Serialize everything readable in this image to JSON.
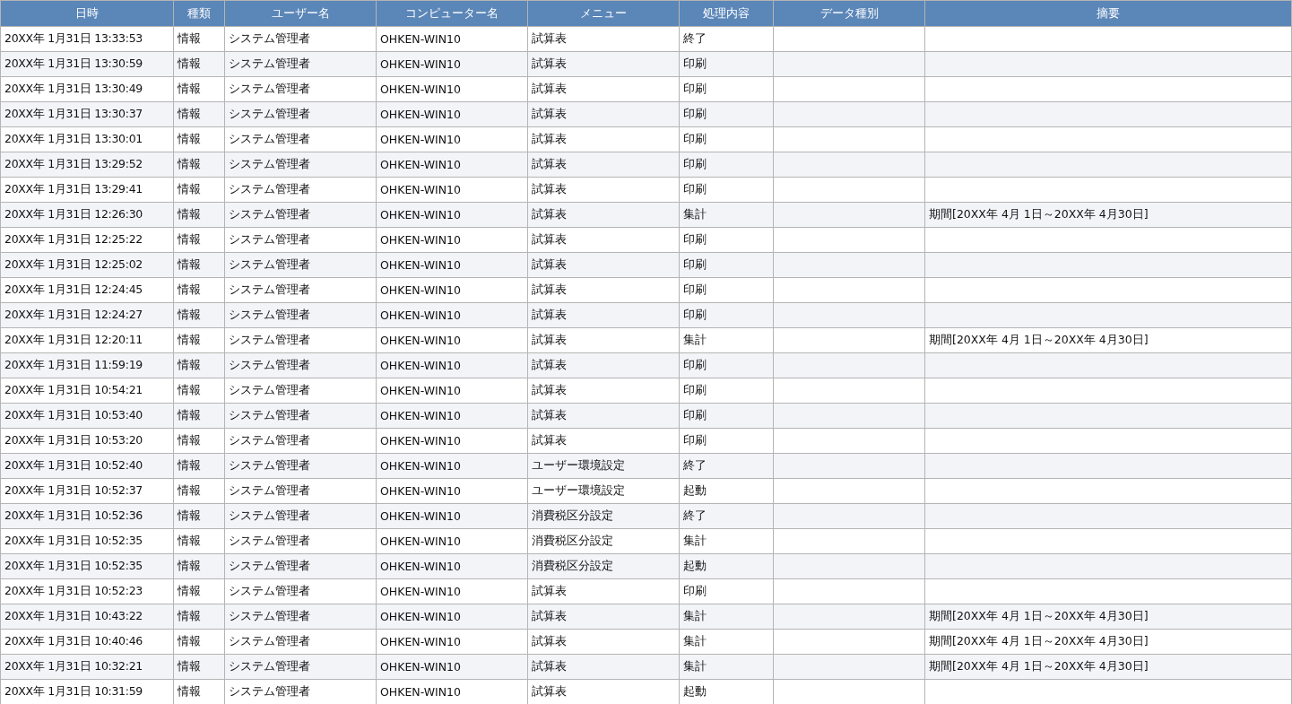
{
  "table": {
    "columns": [
      "日時",
      "種類",
      "ユーザー名",
      "コンピューター名",
      "メニュー",
      "処理内容",
      "データ種別",
      "摘要"
    ],
    "rows": [
      {
        "datetime": "20XX年 1月31日 13:33:53",
        "type": "情報",
        "user": "システム管理者",
        "computer": "OHKEN-WIN10",
        "menu": "試算表",
        "process": "終了"
      },
      {
        "datetime": "20XX年 1月31日 13:30:59",
        "type": "情報",
        "user": "システム管理者",
        "computer": "OHKEN-WIN10",
        "menu": "試算表",
        "process": "印刷"
      },
      {
        "datetime": "20XX年 1月31日 13:30:49",
        "type": "情報",
        "user": "システム管理者",
        "computer": "OHKEN-WIN10",
        "menu": "試算表",
        "process": "印刷"
      },
      {
        "datetime": "20XX年 1月31日 13:30:37",
        "type": "情報",
        "user": "システム管理者",
        "computer": "OHKEN-WIN10",
        "menu": "試算表",
        "process": "印刷"
      },
      {
        "datetime": "20XX年 1月31日 13:30:01",
        "type": "情報",
        "user": "システム管理者",
        "computer": "OHKEN-WIN10",
        "menu": "試算表",
        "process": "印刷"
      },
      {
        "datetime": "20XX年 1月31日 13:29:52",
        "type": "情報",
        "user": "システム管理者",
        "computer": "OHKEN-WIN10",
        "menu": "試算表",
        "process": "印刷"
      },
      {
        "datetime": "20XX年 1月31日 13:29:41",
        "type": "情報",
        "user": "システム管理者",
        "computer": "OHKEN-WIN10",
        "menu": "試算表",
        "process": "印刷"
      },
      {
        "datetime": "20XX年 1月31日 12:26:30",
        "type": "情報",
        "user": "システム管理者",
        "computer": "OHKEN-WIN10",
        "menu": "試算表",
        "process": "集計",
        "summary": "期間[20XX年 4月 1日～20XX年 4月30日]"
      },
      {
        "datetime": "20XX年 1月31日 12:25:22",
        "type": "情報",
        "user": "システム管理者",
        "computer": "OHKEN-WIN10",
        "menu": "試算表",
        "process": "印刷"
      },
      {
        "datetime": "20XX年 1月31日 12:25:02",
        "type": "情報",
        "user": "システム管理者",
        "computer": "OHKEN-WIN10",
        "menu": "試算表",
        "process": "印刷"
      },
      {
        "datetime": "20XX年 1月31日 12:24:45",
        "type": "情報",
        "user": "システム管理者",
        "computer": "OHKEN-WIN10",
        "menu": "試算表",
        "process": "印刷"
      },
      {
        "datetime": "20XX年 1月31日 12:24:27",
        "type": "情報",
        "user": "システム管理者",
        "computer": "OHKEN-WIN10",
        "menu": "試算表",
        "process": "印刷"
      },
      {
        "datetime": "20XX年 1月31日 12:20:11",
        "type": "情報",
        "user": "システム管理者",
        "computer": "OHKEN-WIN10",
        "menu": "試算表",
        "process": "集計",
        "summary": "期間[20XX年 4月 1日～20XX年 4月30日]"
      },
      {
        "datetime": "20XX年 1月31日 11:59:19",
        "type": "情報",
        "user": "システム管理者",
        "computer": "OHKEN-WIN10",
        "menu": "試算表",
        "process": "印刷"
      },
      {
        "datetime": "20XX年 1月31日 10:54:21",
        "type": "情報",
        "user": "システム管理者",
        "computer": "OHKEN-WIN10",
        "menu": "試算表",
        "process": "印刷"
      },
      {
        "datetime": "20XX年 1月31日 10:53:40",
        "type": "情報",
        "user": "システム管理者",
        "computer": "OHKEN-WIN10",
        "menu": "試算表",
        "process": "印刷"
      },
      {
        "datetime": "20XX年 1月31日 10:53:20",
        "type": "情報",
        "user": "システム管理者",
        "computer": "OHKEN-WIN10",
        "menu": "試算表",
        "process": "印刷"
      },
      {
        "datetime": "20XX年 1月31日 10:52:40",
        "type": "情報",
        "user": "システム管理者",
        "computer": "OHKEN-WIN10",
        "menu": "ユーザー環境設定",
        "process": "終了"
      },
      {
        "datetime": "20XX年 1月31日 10:52:37",
        "type": "情報",
        "user": "システム管理者",
        "computer": "OHKEN-WIN10",
        "menu": "ユーザー環境設定",
        "process": "起動"
      },
      {
        "datetime": "20XX年 1月31日 10:52:36",
        "type": "情報",
        "user": "システム管理者",
        "computer": "OHKEN-WIN10",
        "menu": "消費税区分設定",
        "process": "終了"
      },
      {
        "datetime": "20XX年 1月31日 10:52:35",
        "type": "情報",
        "user": "システム管理者",
        "computer": "OHKEN-WIN10",
        "menu": "消費税区分設定",
        "process": "集計"
      },
      {
        "datetime": "20XX年 1月31日 10:52:35",
        "type": "情報",
        "user": "システム管理者",
        "computer": "OHKEN-WIN10",
        "menu": "消費税区分設定",
        "process": "起動"
      },
      {
        "datetime": "20XX年 1月31日 10:52:23",
        "type": "情報",
        "user": "システム管理者",
        "computer": "OHKEN-WIN10",
        "menu": "試算表",
        "process": "印刷"
      },
      {
        "datetime": "20XX年 1月31日 10:43:22",
        "type": "情報",
        "user": "システム管理者",
        "computer": "OHKEN-WIN10",
        "menu": "試算表",
        "process": "集計",
        "summary": "期間[20XX年 4月 1日～20XX年 4月30日]"
      },
      {
        "datetime": "20XX年 1月31日 10:40:46",
        "type": "情報",
        "user": "システム管理者",
        "computer": "OHKEN-WIN10",
        "menu": "試算表",
        "process": "集計",
        "summary": "期間[20XX年 4月 1日～20XX年 4月30日]"
      },
      {
        "datetime": "20XX年 1月31日 10:32:21",
        "type": "情報",
        "user": "システム管理者",
        "computer": "OHKEN-WIN10",
        "menu": "試算表",
        "process": "集計",
        "summary": "期間[20XX年 4月 1日～20XX年 4月30日]"
      },
      {
        "datetime": "20XX年 1月31日 10:31:59",
        "type": "情報",
        "user": "システム管理者",
        "computer": "OHKEN-WIN10",
        "menu": "試算表",
        "process": "起動"
      }
    ]
  }
}
